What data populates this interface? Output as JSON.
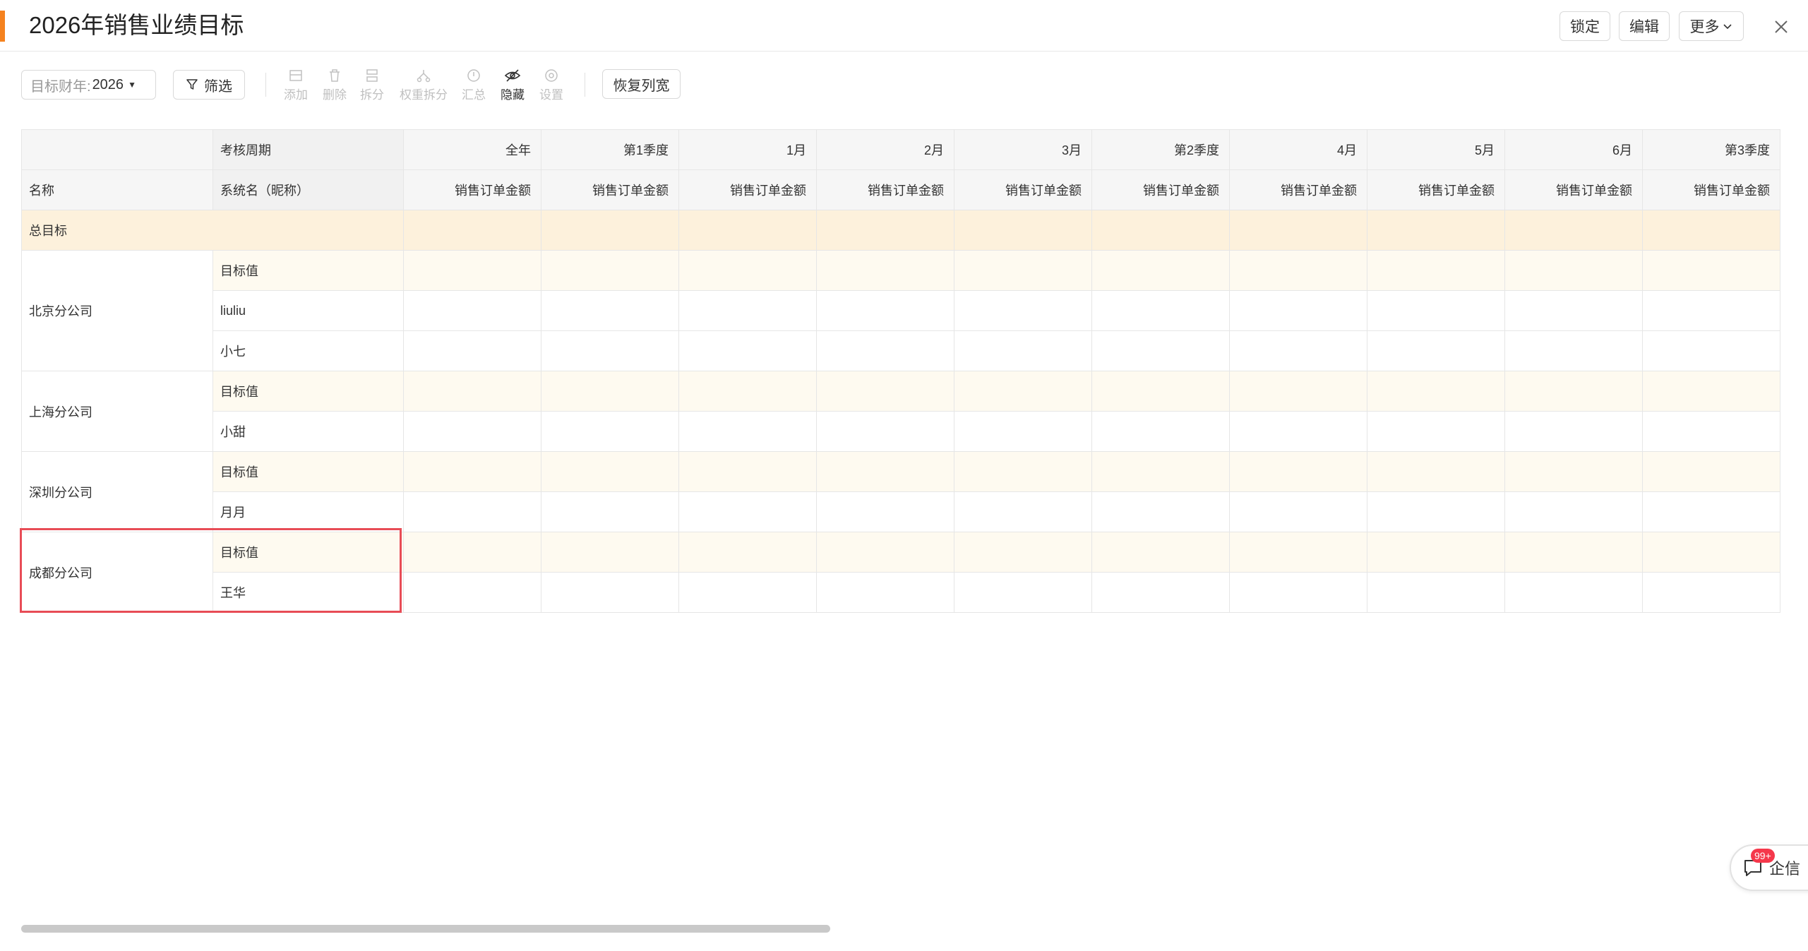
{
  "header": {
    "title": "2026年销售业绩目标",
    "lock_label": "锁定",
    "edit_label": "编辑",
    "more_label": "更多"
  },
  "toolbar": {
    "year_label": "目标财年:",
    "year_value": "2026",
    "filter_label": "筛选",
    "tools": [
      {
        "label": "添加",
        "icon": "add-icon",
        "enabled": false
      },
      {
        "label": "删除",
        "icon": "delete-icon",
        "enabled": false
      },
      {
        "label": "拆分",
        "icon": "split-icon",
        "enabled": false
      },
      {
        "label": "权重拆分",
        "icon": "weight-split-icon",
        "enabled": false
      },
      {
        "label": "汇总",
        "icon": "summary-icon",
        "enabled": false
      },
      {
        "label": "隐藏",
        "icon": "hide-icon",
        "enabled": true
      },
      {
        "label": "设置",
        "icon": "settings-icon",
        "enabled": false
      }
    ],
    "restore_label": "恢复列宽"
  },
  "table": {
    "period_header": "考核周期",
    "name_header": "名称",
    "sysname_header": "系统名（昵称）",
    "periods": [
      "全年",
      "第1季度",
      "1月",
      "2月",
      "3月",
      "第2季度",
      "4月",
      "5月",
      "6月",
      "第3季度"
    ],
    "metric": "销售订单金额",
    "total_label": "总目标",
    "groups": [
      {
        "name": "北京分公司",
        "rows": [
          "目标值",
          "liuliu",
          "小七"
        ]
      },
      {
        "name": "上海分公司",
        "rows": [
          "目标值",
          "小甜"
        ]
      },
      {
        "name": "深圳分公司",
        "rows": [
          "目标值",
          "月月"
        ]
      },
      {
        "name": "成都分公司",
        "rows": [
          "目标值",
          "王华"
        ]
      }
    ]
  },
  "chat": {
    "label": "企信",
    "badge": "99+"
  },
  "colors": {
    "accent": "#f5821f",
    "total_row_bg": "#fdf1dc",
    "target_row_bg": "#fefaf0",
    "highlight_border": "#e84c56",
    "badge": "#f5384b"
  }
}
